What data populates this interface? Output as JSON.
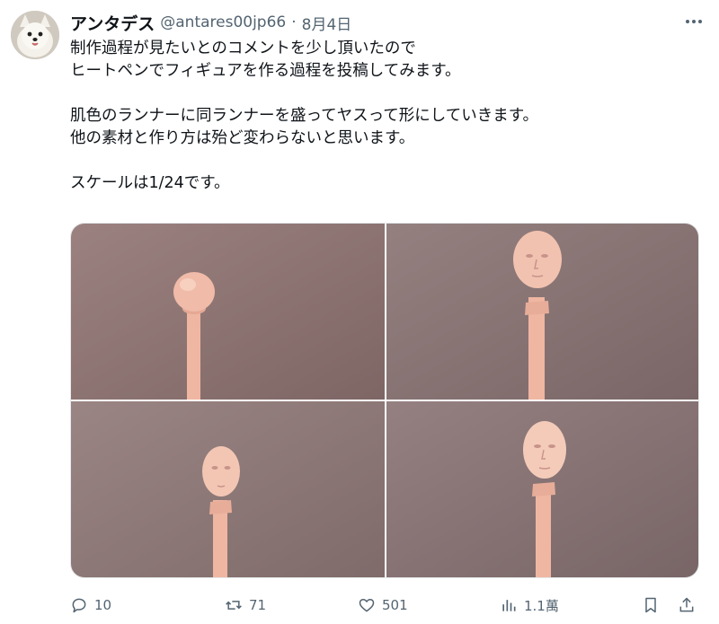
{
  "tweet": {
    "display_name": "アンタデス",
    "handle": "@antares00jp66",
    "separator": "·",
    "date": "8月4日",
    "lines": [
      "制作過程が見たいとのコメントを少し頂いたので",
      "ヒートペンでフィギュアを作る過程を投稿してみます。",
      "肌色のランナーに同ランナーを盛ってヤスって形にしていきます。",
      "他の素材と作り方は殆ど変わらないと思います。",
      "スケールは1/24です。"
    ],
    "media_count": 4
  },
  "actions": {
    "reply_count": "10",
    "retweet_count": "71",
    "like_count": "501",
    "view_count": "1.1萬"
  },
  "icons": {
    "avatar": "dog-avatar-icon",
    "more": "more-dots-icon",
    "reply": "reply-icon",
    "retweet": "retweet-icon",
    "like": "heart-icon",
    "views": "views-chart-icon",
    "bookmark": "bookmark-icon",
    "share": "share-icon"
  },
  "colors": {
    "text_primary": "#0f1419",
    "text_secondary": "#536471",
    "photo_background": "#8f7775",
    "figure_skin": "#f2c4b0"
  }
}
